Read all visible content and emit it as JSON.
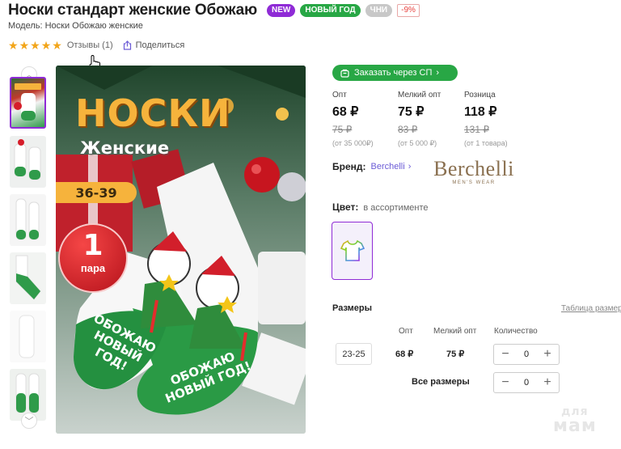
{
  "product": {
    "title": "Носки стандарт женские Обожаю",
    "badges": {
      "new": "NEW",
      "new_year": "НОВЫЙ ГОД",
      "chn": "ЧНИ",
      "discount": "-9%"
    },
    "model": "Модель: Носки Обожаю женские"
  },
  "rating": {
    "stars": 5,
    "reviews_label": "Отзывы (1)",
    "share_label": "Поделиться"
  },
  "image_text": {
    "title": "НОСКИ",
    "subtitle": "Женские",
    "size": "36-39",
    "pair_number": "1",
    "pair_word": "пара",
    "phrase1": "ОБОЖАЮ НОВЫЙ ГОД!",
    "phrase2": "ОБОЖАЮ НОВЫЙ ГОД!"
  },
  "order": {
    "label": "Заказать через СП"
  },
  "prices": [
    {
      "label": "Опт",
      "value": "68 ₽",
      "old": "75 ₽",
      "note": "(от 35 000₽)"
    },
    {
      "label": "Мелкий опт",
      "value": "75 ₽",
      "old": "83 ₽",
      "note": "(от 5 000 ₽)"
    },
    {
      "label": "Розница",
      "value": "118 ₽",
      "old": "131 ₽",
      "note": "(от 1 товара)"
    }
  ],
  "brand": {
    "label": "Бренд:",
    "name": "Berchelli",
    "logo_main": "Berchelli",
    "logo_sub": "MEN'S WEAR"
  },
  "color": {
    "label": "Цвет:",
    "value": "в ассортименте"
  },
  "sizes": {
    "title": "Размеры",
    "table_link": "Таблица размеров",
    "columns": [
      "Опт",
      "Мелкий опт",
      "Количество"
    ],
    "rows": [
      {
        "size": "23-25",
        "opt": "68 ₽",
        "small_opt": "75 ₽",
        "qty": "0"
      }
    ],
    "all_sizes_label": "Все размеры",
    "all_sizes_qty": "0"
  },
  "watermark": {
    "line1": "для",
    "line2": "мам"
  },
  "colors": {
    "accent": "#8f2bd6",
    "green": "#28a745",
    "star": "#f2a51a",
    "link": "#6b5bd6"
  }
}
